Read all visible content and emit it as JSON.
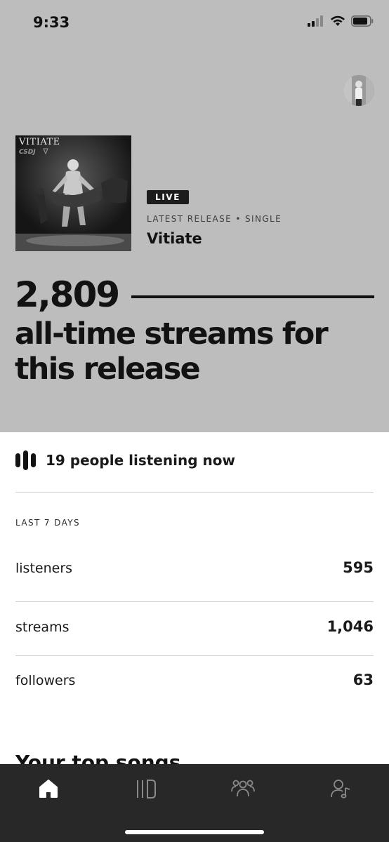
{
  "status_bar": {
    "time": "9:33"
  },
  "release": {
    "cover_text": "VITIATE",
    "badge": "LIVE",
    "meta": "LATEST RELEASE • SINGLE",
    "title": "Vitiate"
  },
  "streams": {
    "count": "2,809",
    "caption": "all-time streams for this release"
  },
  "listening": {
    "text": "19 people listening now"
  },
  "stats": {
    "period": "LAST 7 DAYS",
    "rows": [
      {
        "label": "listeners",
        "value": "595"
      },
      {
        "label": "streams",
        "value": "1,046"
      },
      {
        "label": "followers",
        "value": "63"
      }
    ]
  },
  "section": {
    "heading": "Your top songs"
  },
  "tab_bar": {
    "tabs": [
      {
        "icon": "home-icon",
        "active": true
      },
      {
        "icon": "music-library-icon",
        "active": false
      },
      {
        "icon": "audience-icon",
        "active": false
      },
      {
        "icon": "artist-profile-icon",
        "active": false
      }
    ]
  },
  "colors": {
    "hero_bg": "#bdbdbd",
    "tab_bar_bg": "#282828",
    "text": "#121212"
  }
}
